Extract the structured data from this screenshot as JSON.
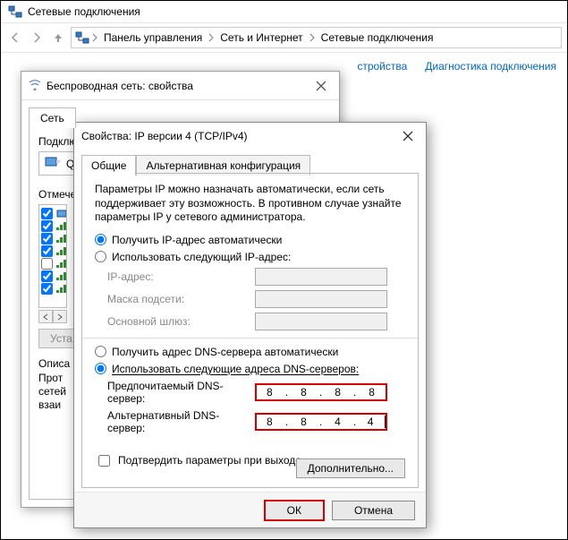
{
  "explorer": {
    "title": "Сетевые подключения",
    "breadcrumb": [
      "Панель управления",
      "Сеть и Интернет",
      "Сетевые подключения"
    ],
    "toolbar": {
      "link1": "стройства",
      "link2": "Диагностика подключения"
    }
  },
  "dlg1": {
    "title": "Беспроводная сеть: свойства",
    "tab": "Сеть",
    "connect_label": "Подклю",
    "adapter_stub": "Q",
    "checked_caption": "Отмече",
    "items": [
      {
        "checked": true,
        "icon": "blue"
      },
      {
        "checked": true,
        "icon": "green"
      },
      {
        "checked": true,
        "icon": "green"
      },
      {
        "checked": true,
        "icon": "green"
      },
      {
        "checked": false,
        "icon": "green"
      },
      {
        "checked": true,
        "icon": "green"
      },
      {
        "checked": true,
        "icon": "green"
      }
    ],
    "install_btn": "Уста",
    "desc_title": "Описа",
    "desc_lines": [
      "Прот",
      "сетей",
      "взаи"
    ]
  },
  "dlg2": {
    "title": "Свойства: IP версии 4 (TCP/IPv4)",
    "tabs": [
      "Общие",
      "Альтернативная конфигурация"
    ],
    "info": "Параметры IP можно назначать автоматически, если сеть поддерживает эту возможность. В противном случае узнайте параметры IP у сетевого администратора.",
    "radio_auto_ip": "Получить IP-адрес автоматически",
    "radio_manual_ip": "Использовать следующий IP-адрес:",
    "ip_label": "IP-адрес:",
    "mask_label": "Маска подсети:",
    "gw_label": "Основной шлюз:",
    "radio_auto_dns": "Получить адрес DNS-сервера автоматически",
    "radio_manual_dns": "Использовать следующие адреса DNS-серверов:",
    "dns1_label": "Предпочитаемый DNS-сервер:",
    "dns2_label": "Альтернативный DNS-сервер:",
    "dns1": [
      "8",
      "8",
      "8",
      "8"
    ],
    "dns2": [
      "8",
      "8",
      "4",
      "4"
    ],
    "confirm_chk": "Подтвердить параметры при выходе",
    "advanced": "Дополнительно...",
    "ok": "ОК",
    "cancel": "Отмена"
  }
}
